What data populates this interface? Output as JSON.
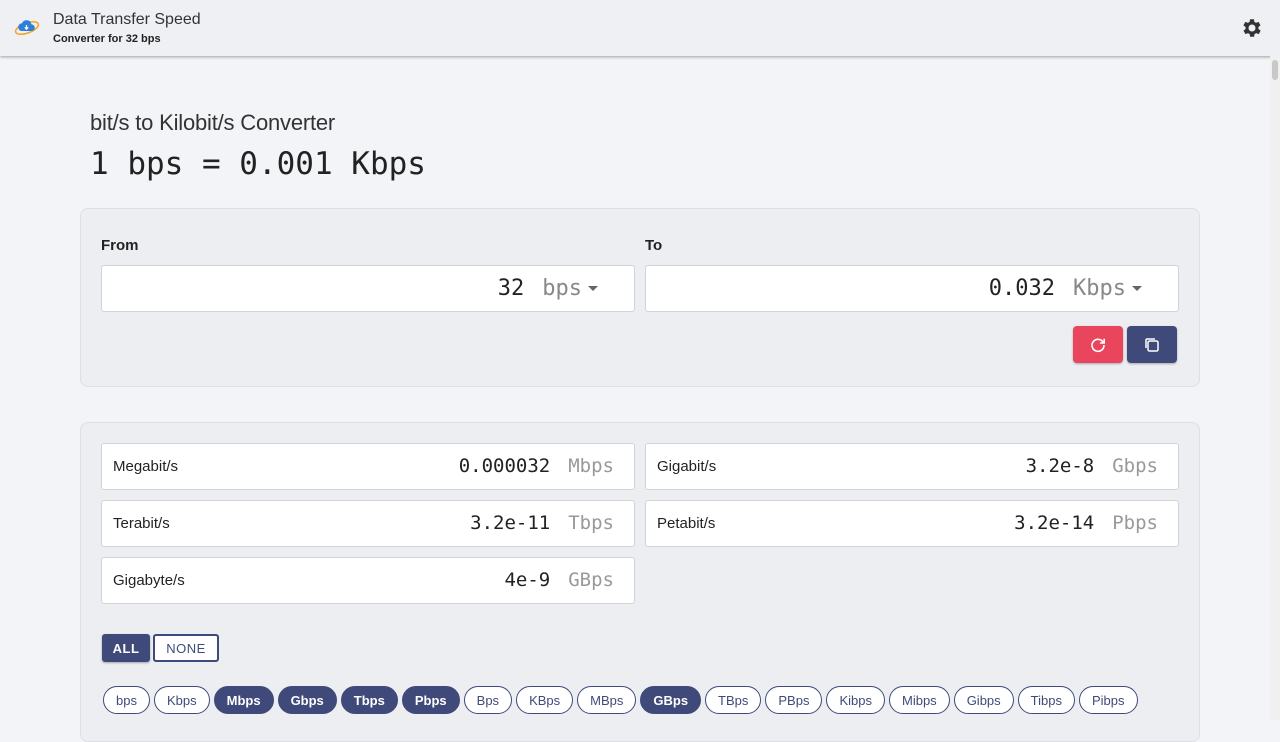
{
  "header": {
    "title": "Data Transfer Speed",
    "subtitle": "Converter for 32 bps"
  },
  "page": {
    "heading": "bit/s to Kilobit/s Converter",
    "formula": "1 bps = 0.001 Kbps"
  },
  "converter": {
    "from_label": "From",
    "to_label": "To",
    "from_value": "32",
    "from_unit": "bps",
    "to_value": "0.032",
    "to_unit": "Kbps"
  },
  "results": [
    {
      "name": "Megabit/s",
      "value": "0.000032",
      "unit": "Mbps"
    },
    {
      "name": "Gigabit/s",
      "value": "3.2e-8",
      "unit": "Gbps"
    },
    {
      "name": "Terabit/s",
      "value": "3.2e-11",
      "unit": "Tbps"
    },
    {
      "name": "Petabit/s",
      "value": "3.2e-14",
      "unit": "Pbps"
    },
    {
      "name": "Gigabyte/s",
      "value": "4e-9",
      "unit": "GBps"
    }
  ],
  "selection": {
    "all_label": "ALL",
    "none_label": "NONE"
  },
  "chips": [
    {
      "label": "bps",
      "selected": false
    },
    {
      "label": "Kbps",
      "selected": false
    },
    {
      "label": "Mbps",
      "selected": true
    },
    {
      "label": "Gbps",
      "selected": true
    },
    {
      "label": "Tbps",
      "selected": true
    },
    {
      "label": "Pbps",
      "selected": true
    },
    {
      "label": "Bps",
      "selected": false
    },
    {
      "label": "KBps",
      "selected": false
    },
    {
      "label": "MBps",
      "selected": false
    },
    {
      "label": "GBps",
      "selected": true
    },
    {
      "label": "TBps",
      "selected": false
    },
    {
      "label": "PBps",
      "selected": false
    },
    {
      "label": "Kibps",
      "selected": false
    },
    {
      "label": "Mibps",
      "selected": false
    },
    {
      "label": "Gibps",
      "selected": false
    },
    {
      "label": "Tibps",
      "selected": false
    },
    {
      "label": "Pibps",
      "selected": false
    }
  ],
  "colors": {
    "accent": "#3f4a7a",
    "reset": "#e9455c"
  },
  "icons": {
    "logo": "cloud-sync-icon",
    "settings": "gear-icon",
    "reset": "refresh-icon",
    "copy": "copy-icon"
  }
}
